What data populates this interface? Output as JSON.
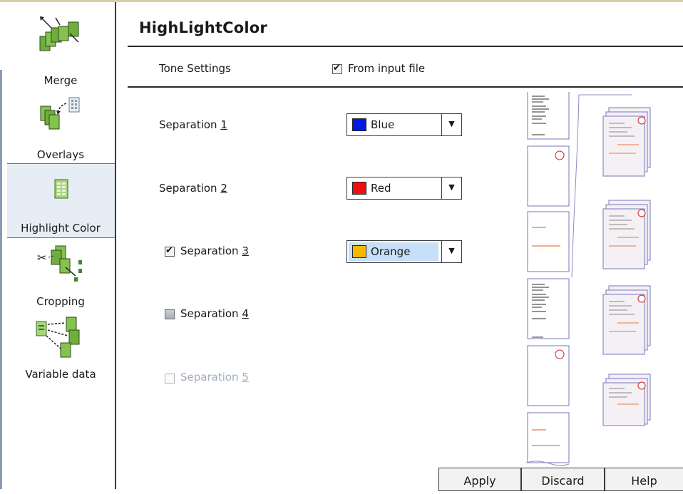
{
  "sidebar": {
    "items": [
      {
        "label": "Merge",
        "icon": "merge-icon",
        "selected": false
      },
      {
        "label": "Overlays",
        "icon": "overlays-icon",
        "selected": false
      },
      {
        "label": "Highlight Color",
        "icon": "highlight-color-icon",
        "selected": true
      },
      {
        "label": "Cropping",
        "icon": "cropping-icon",
        "selected": false
      },
      {
        "label": "Variable data",
        "icon": "variable-data-icon",
        "selected": false
      }
    ]
  },
  "main": {
    "title": "HighLightColor",
    "tone_settings_label": "Tone Settings",
    "from_input_file": {
      "label": "From input file",
      "checked": true
    },
    "separations": [
      {
        "label_prefix": "Separation ",
        "mnemonic": "1",
        "has_checkbox": false,
        "color_name": "Blue",
        "swatch": "#0018e8"
      },
      {
        "label_prefix": "Separation ",
        "mnemonic": "2",
        "has_checkbox": false,
        "color_name": "Red",
        "swatch": "#ee1010"
      },
      {
        "label_prefix": "Separation ",
        "mnemonic": "3",
        "has_checkbox": true,
        "checked": true,
        "color_name": "Orange",
        "swatch": "#f8b800"
      },
      {
        "label_prefix": "Separation ",
        "mnemonic": "4",
        "has_checkbox": true,
        "checked": false
      },
      {
        "label_prefix": "Separation ",
        "mnemonic": "5",
        "has_checkbox": true,
        "checked": false,
        "disabled": true
      }
    ]
  },
  "buttons": {
    "apply": "Apply",
    "discard": "Discard",
    "help": "Help"
  },
  "colors": {
    "accent_selected_bg": "#e6edf4",
    "dropdown_selected_bg": "#c7dff7",
    "disabled_text": "#a2aec0"
  }
}
